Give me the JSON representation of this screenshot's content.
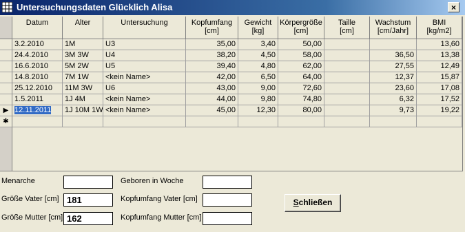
{
  "window": {
    "title": "Untersuchungsdaten Glücklich Alisa",
    "close_label": "×"
  },
  "grid": {
    "columns": [
      {
        "label1": "Datum",
        "label2": ""
      },
      {
        "label1": "Alter",
        "label2": ""
      },
      {
        "label1": "Untersuchung",
        "label2": ""
      },
      {
        "label1": "Kopfumfang",
        "label2": "[cm]"
      },
      {
        "label1": "Gewicht",
        "label2": "[kg]"
      },
      {
        "label1": "Körpergröße",
        "label2": "[cm]"
      },
      {
        "label1": "Taille",
        "label2": "[cm]"
      },
      {
        "label1": "Wachstum",
        "label2": "[cm/Jahr]"
      },
      {
        "label1": "BMI",
        "label2": "[kg/m2]"
      }
    ],
    "rows": [
      [
        "3.2.2010",
        "1M",
        "U3",
        "35,00",
        "3,40",
        "50,00",
        "",
        "",
        "13,60"
      ],
      [
        "24.4.2010",
        "3M 3W",
        "U4",
        "38,20",
        "4,50",
        "58,00",
        "",
        "36,50",
        "13,38"
      ],
      [
        "16.6.2010",
        "5M 2W",
        "U5",
        "39,40",
        "4,80",
        "62,00",
        "",
        "27,55",
        "12,49"
      ],
      [
        "14.8.2010",
        "7M 1W",
        "<kein Name>",
        "42,00",
        "6,50",
        "64,00",
        "",
        "12,37",
        "15,87"
      ],
      [
        "25.12.2010",
        "11M 3W",
        "U6",
        "43,00",
        "9,00",
        "72,60",
        "",
        "23,60",
        "17,08"
      ],
      [
        "1.5.2011",
        "1J 4M",
        "<kein Name>",
        "44,00",
        "9,80",
        "74,80",
        "",
        "6,32",
        "17,52"
      ],
      [
        "12.11.2011",
        "1J 10M 1W",
        "<kein Name>",
        "45,00",
        "12,30",
        "80,00",
        "",
        "9,73",
        "19,22"
      ]
    ],
    "current_row_marker": "▶",
    "new_row_marker": "✱"
  },
  "form": {
    "menarche_label": "Menarche",
    "menarche_value": "",
    "geboren_label": "Geboren in Woche",
    "geboren_value": "",
    "groesse_vater_label": "Größe Vater [cm]",
    "groesse_vater_value": "181",
    "kopfumfang_vater_label": "Kopfumfang Vater [cm]",
    "kopfumfang_vater_value": "",
    "groesse_mutter_label": "Größe Mutter [cm]",
    "groesse_mutter_value": "162",
    "kopfumfang_mutter_label": "Kopfumfang Mutter [cm]",
    "kopfumfang_mutter_value": ""
  },
  "buttons": {
    "close_first": "S",
    "close_rest": "chließen"
  }
}
